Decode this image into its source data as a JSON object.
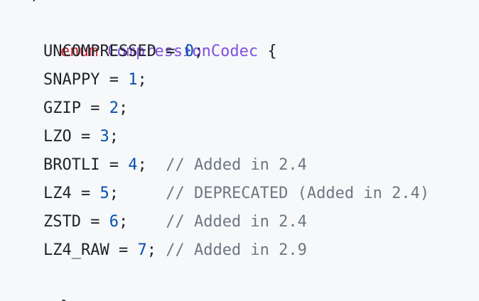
{
  "code": {
    "partial_top": "*/",
    "keyword": "enum",
    "type_name": "CompressionCodec",
    "open_brace": "{",
    "close_brace": "}",
    "entries": [
      {
        "name": "UNCOMPRESSED",
        "eq": " = ",
        "value": "0",
        "semi": ";",
        "pad": "",
        "comment": ""
      },
      {
        "name": "SNAPPY",
        "eq": " = ",
        "value": "1",
        "semi": ";",
        "pad": "",
        "comment": ""
      },
      {
        "name": "GZIP",
        "eq": " = ",
        "value": "2",
        "semi": ";",
        "pad": "",
        "comment": ""
      },
      {
        "name": "LZO",
        "eq": " = ",
        "value": "3",
        "semi": ";",
        "pad": "",
        "comment": ""
      },
      {
        "name": "BROTLI",
        "eq": " = ",
        "value": "4",
        "semi": ";",
        "pad": "  ",
        "comment": "// Added in 2.4"
      },
      {
        "name": "LZ4",
        "eq": " = ",
        "value": "5",
        "semi": ";",
        "pad": "     ",
        "comment": "// DEPRECATED (Added in 2.4)"
      },
      {
        "name": "ZSTD",
        "eq": " = ",
        "value": "6",
        "semi": ";",
        "pad": "    ",
        "comment": "// Added in 2.4"
      },
      {
        "name": "LZ4_RAW",
        "eq": " = ",
        "value": "7",
        "semi": ";",
        "pad": " ",
        "comment": "// Added in 2.9"
      }
    ]
  }
}
